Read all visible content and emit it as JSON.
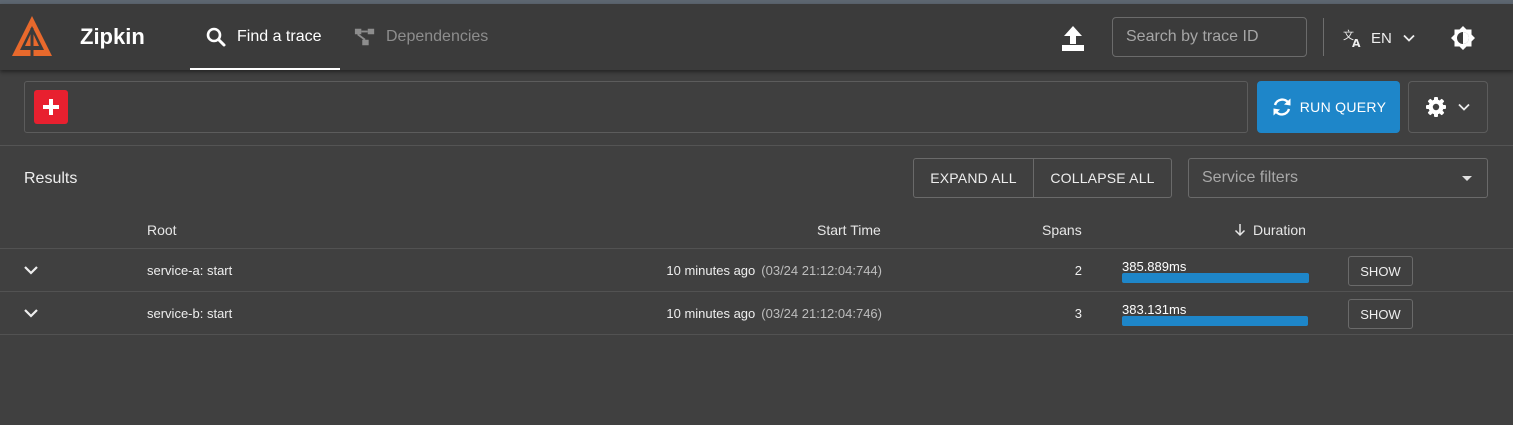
{
  "colors": {
    "background": "#404040",
    "appbar": "#3b3b3b",
    "accent_blue": "#1e86c9",
    "add_red": "#e8202f",
    "logo_orange": "#e8692c"
  },
  "header": {
    "brand": "Zipkin",
    "logo_icon": "zipkin-logo",
    "tabs": [
      {
        "label": "Find a trace",
        "icon": "search-icon",
        "active": true
      },
      {
        "label": "Dependencies",
        "icon": "dependencies-icon",
        "active": false
      }
    ],
    "upload_icon": "upload-icon",
    "trace_search_placeholder": "Search by trace ID",
    "language": {
      "label": "EN",
      "icon": "translate-icon"
    },
    "theme_icon": "theme-toggle-icon"
  },
  "query": {
    "add_icon": "plus-icon",
    "run_label": "RUN QUERY",
    "run_icon": "refresh-icon",
    "settings_icon": "gear-icon"
  },
  "results": {
    "title": "Results",
    "expand_all": "EXPAND ALL",
    "collapse_all": "COLLAPSE ALL",
    "service_filters_placeholder": "Service filters",
    "columns": {
      "root": "Root",
      "start_time": "Start Time",
      "spans": "Spans",
      "duration": "Duration"
    },
    "duration_sort": "descending",
    "rows": [
      {
        "root": "service-a: start",
        "start_relative": "10 minutes ago",
        "start_absolute": "(03/24 21:12:04:744)",
        "spans": "2",
        "duration": "385.889ms",
        "duration_fraction": 1.0,
        "show": "SHOW"
      },
      {
        "root": "service-b: start",
        "start_relative": "10 minutes ago",
        "start_absolute": "(03/24 21:12:04:746)",
        "spans": "3",
        "duration": "383.131ms",
        "duration_fraction": 0.993,
        "show": "SHOW"
      }
    ]
  }
}
